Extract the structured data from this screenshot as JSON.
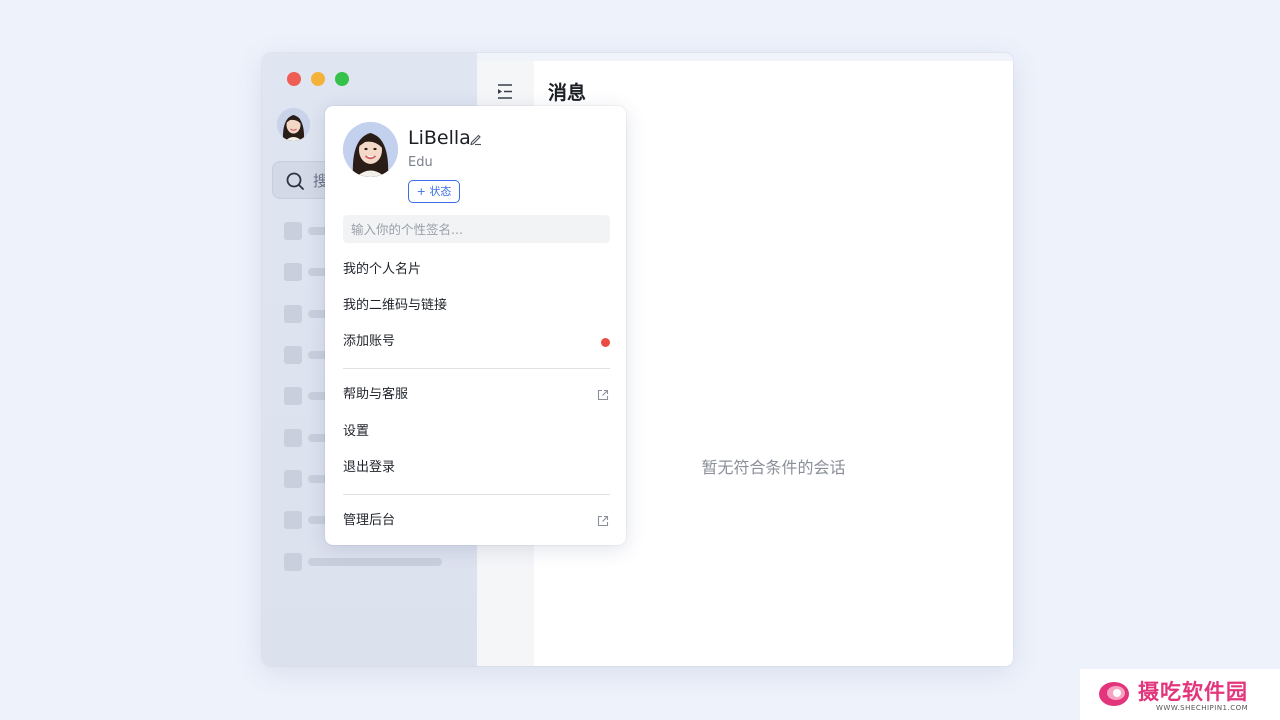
{
  "sidebar": {
    "search_placeholder": "搜"
  },
  "main": {
    "title": "消息",
    "empty_text": "暂无符合条件的会话"
  },
  "profile_menu": {
    "name": "LiBella",
    "org": "Edu",
    "status_button": "+ 状态",
    "signature_placeholder": "输入你的个性签名...",
    "items": {
      "business_card": "我的个人名片",
      "qr_code": "我的二维码与链接",
      "add_account": "添加账号",
      "help": "帮助与客服",
      "settings": "设置",
      "logout": "退出登录",
      "admin": "管理后台"
    }
  },
  "watermark": {
    "text": "摄吃软件园",
    "url": "WWW.SHECHIPIN1.COM"
  },
  "colors": {
    "accent": "#3b6ee6",
    "notification_dot": "#eb4b43"
  }
}
